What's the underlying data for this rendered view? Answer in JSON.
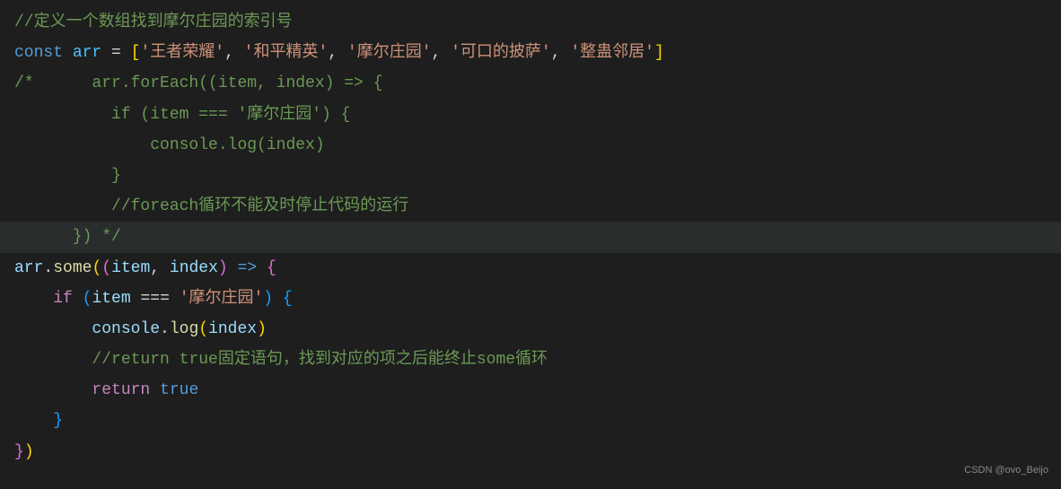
{
  "code": {
    "line1_comment": "//定义一个数组找到摩尔庄园的索引号",
    "line2_const": "const",
    "line2_arr": "arr",
    "line2_eq": " = ",
    "line2_str1": "'王者荣耀'",
    "line2_str2": "'和平精英'",
    "line2_str3": "'摩尔庄园'",
    "line2_str4": "'可口的披萨'",
    "line2_str5": "'整蛊邻居'",
    "line3_comment_start": "/*      arr.forEach((item, index) => {",
    "line4_comment": "          if (item === '摩尔庄园') {",
    "line5_comment": "              console.log(index)",
    "line6_comment": "          }",
    "line7_comment": "          //foreach循环不能及时停止代码的运行",
    "line8_comment": "      }) */",
    "line9_arr": "arr",
    "line9_some": "some",
    "line9_item": "item",
    "line9_index": "index",
    "line9_arrow": " => ",
    "line10_if": "if",
    "line10_item": "item",
    "line10_eqeqeq": " === ",
    "line10_str": "'摩尔庄园'",
    "line11_console": "console",
    "line11_log": "log",
    "line11_index": "index",
    "line12_comment": "//return true固定语句，找到对应的项之后能终止some循环",
    "line13_return": "return",
    "line13_true": "true",
    "watermark": "CSDN @ovo_Beijo"
  }
}
